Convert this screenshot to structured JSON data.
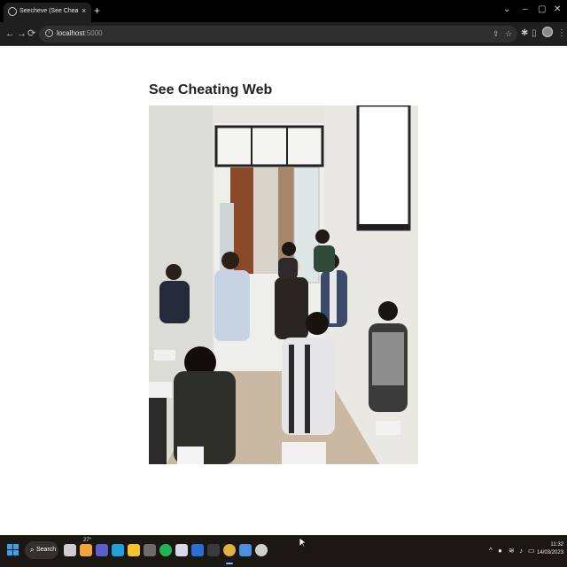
{
  "browser": {
    "tab_title": "Seecheve (See Cheating Web)",
    "tab_close": "×",
    "new_tab": "+",
    "url_host": "localhost",
    "url_port": ":5000",
    "window_controls": {
      "chevron": "⌄",
      "minimize": "–",
      "maximize": "▢",
      "close": "✕"
    },
    "nav": {
      "back": "←",
      "forward": "→",
      "reload": "⟳"
    }
  },
  "page": {
    "title": "See Cheating Web",
    "image_label": "Classroom camera frame showing students seated at desks"
  },
  "taskbar": {
    "search_label": "Search",
    "temperature": "27°",
    "time": "11:32",
    "date": "14/03/2023",
    "apps": [
      {
        "name": "task-view",
        "color": "#cfcfcf"
      },
      {
        "name": "widgets",
        "color": "#f2a33a"
      },
      {
        "name": "teams",
        "color": "#5b5fc7"
      },
      {
        "name": "edge",
        "color": "#1fa2d8"
      },
      {
        "name": "file-explorer",
        "color": "#f4c430"
      },
      {
        "name": "calculator",
        "color": "#6b6b6b"
      },
      {
        "name": "spotify",
        "color": "#1db954"
      },
      {
        "name": "photos",
        "color": "#d8d8e8"
      },
      {
        "name": "word",
        "color": "#2b6fd6"
      },
      {
        "name": "terminal",
        "color": "#3a3a3a"
      },
      {
        "name": "chrome",
        "color": "#e0b040"
      },
      {
        "name": "vscode-like",
        "color": "#4a8fe0"
      },
      {
        "name": "github",
        "color": "#d0d0d0"
      }
    ]
  },
  "colors": {
    "tabstrip": "#000000",
    "toolbar": "#1f1f1f",
    "taskbar": "#1b1712",
    "accent": "#7ab8ff"
  }
}
